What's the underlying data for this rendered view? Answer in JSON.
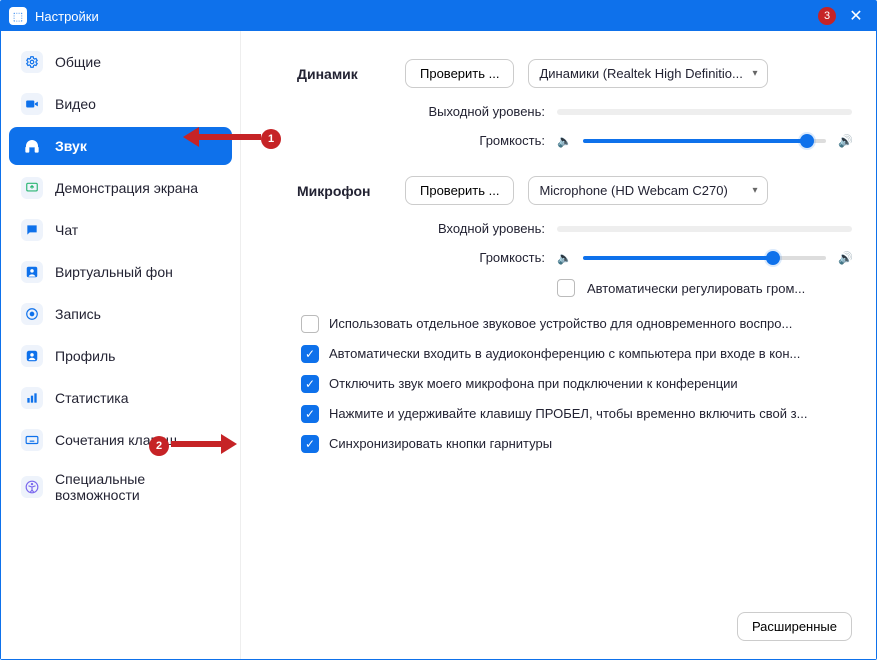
{
  "titlebar": {
    "title": "Настройки",
    "badge": "3"
  },
  "sidebar": {
    "items": [
      {
        "label": "Общие"
      },
      {
        "label": "Видео"
      },
      {
        "label": "Звук"
      },
      {
        "label": "Демонстрация экрана"
      },
      {
        "label": "Чат"
      },
      {
        "label": "Виртуальный фон"
      },
      {
        "label": "Запись"
      },
      {
        "label": "Профиль"
      },
      {
        "label": "Статистика"
      },
      {
        "label": "Сочетания клавиш"
      },
      {
        "label": "Специальные возможности"
      }
    ]
  },
  "speaker": {
    "section": "Динамик",
    "test_btn": "Проверить ...",
    "device": "Динамики (Realtek High Definitio...",
    "output_label": "Выходной уровень:",
    "volume_label": "Громкость:",
    "volume_pct": 92
  },
  "mic": {
    "section": "Микрофон",
    "test_btn": "Проверить ...",
    "device": "Microphone (HD Webcam C270)",
    "input_label": "Входной уровень:",
    "volume_label": "Громкость:",
    "volume_pct": 78,
    "auto_adjust": "Автоматически регулировать гром..."
  },
  "checks": {
    "separate_device": "Использовать отдельное звуковое устройство для одновременного воспро...",
    "auto_join": "Автоматически входить в аудиоконференцию с компьютера при входе в кон...",
    "mute_on_join": "Отключить звук моего микрофона при подключении к конференции",
    "push_to_talk": "Нажмите и удерживайте клавишу ПРОБЕЛ, чтобы временно включить свой з...",
    "sync_headset": "Синхронизировать кнопки гарнитуры"
  },
  "footer": {
    "advanced": "Расширенные"
  },
  "annotations": {
    "b1": "1",
    "b2": "2"
  }
}
